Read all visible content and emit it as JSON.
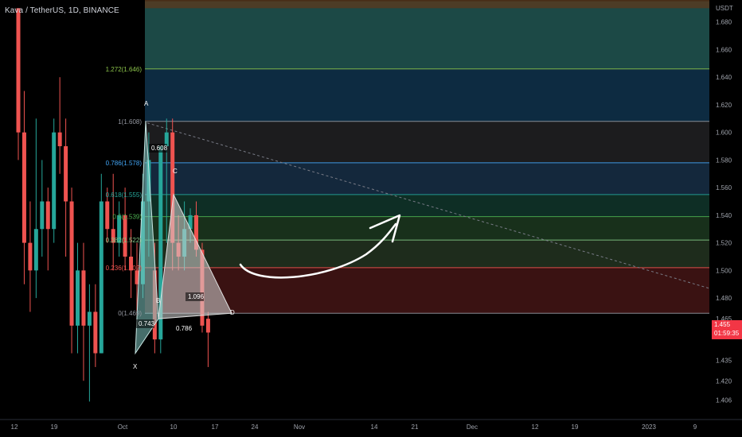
{
  "header": {
    "symbol": "Kava / TetherUS",
    "interval": "1D",
    "exchange": "BINANCE"
  },
  "price_axis": {
    "unit": "USDT",
    "ticks": [
      "1.680",
      "1.660",
      "1.640",
      "1.620",
      "1.600",
      "1.580",
      "1.560",
      "1.540",
      "1.520",
      "1.500",
      "1.480",
      "1.465",
      "1.435",
      "1.420",
      "1.406"
    ],
    "current_price": "1.455",
    "countdown": "01:59:35"
  },
  "time_axis": {
    "ticks": [
      "12",
      "19",
      "Oct",
      "10",
      "17",
      "24",
      "Nov",
      "14",
      "21",
      "Dec",
      "12",
      "19",
      "2023",
      "9"
    ]
  },
  "fib_levels": [
    {
      "label": "1.272(1.646)",
      "color": "#8bc34a"
    },
    {
      "label": "1(1.608)",
      "color": "#9598a1"
    },
    {
      "label": "0.786(1.578)",
      "color": "#42a5f5"
    },
    {
      "label": "0.618(1.555)",
      "color": "#26a69a"
    },
    {
      "label": "0.5(1.539)",
      "color": "#4caf50"
    },
    {
      "label": "0.382(1.522)",
      "color": "#81c784"
    },
    {
      "label": "0.236(1.502)",
      "color": "#ef5350"
    },
    {
      "label": "0(1.469)",
      "color": "#9598a1"
    }
  ],
  "pattern": {
    "points": [
      "X",
      "A",
      "B",
      "C",
      "D"
    ],
    "ratios": [
      "0.608",
      "0.743",
      "1.096",
      "0.786"
    ]
  },
  "colors": {
    "up": "#26a69a",
    "down": "#ef5350",
    "background": "#000000",
    "pattern_fill": "#d6d6d6",
    "arrow": "#ffffff",
    "trendline": "#787b86"
  },
  "chart_data": {
    "type": "candlestick",
    "title": "Kava / TetherUS, 1D, BINANCE",
    "ylabel": "USDT",
    "ylim": [
      1.396,
      1.695
    ],
    "candles": [
      {
        "x": "Sep 10",
        "o": 1.69,
        "h": 1.69,
        "l": 1.58,
        "c": 1.6
      },
      {
        "x": "Sep 11",
        "o": 1.6,
        "h": 1.63,
        "l": 1.49,
        "c": 1.52
      },
      {
        "x": "Sep 12",
        "o": 1.52,
        "h": 1.55,
        "l": 1.47,
        "c": 1.5
      },
      {
        "x": "Sep 13",
        "o": 1.5,
        "h": 1.61,
        "l": 1.48,
        "c": 1.53
      },
      {
        "x": "Sep 14",
        "o": 1.53,
        "h": 1.58,
        "l": 1.51,
        "c": 1.55
      },
      {
        "x": "Sep 15",
        "o": 1.55,
        "h": 1.56,
        "l": 1.5,
        "c": 1.53
      },
      {
        "x": "Sep 16",
        "o": 1.53,
        "h": 1.61,
        "l": 1.52,
        "c": 1.6
      },
      {
        "x": "Sep 17",
        "o": 1.6,
        "h": 1.64,
        "l": 1.57,
        "c": 1.59
      },
      {
        "x": "Sep 18",
        "o": 1.59,
        "h": 1.61,
        "l": 1.51,
        "c": 1.55
      },
      {
        "x": "Sep 19",
        "o": 1.55,
        "h": 1.56,
        "l": 1.44,
        "c": 1.46
      },
      {
        "x": "Sep 20",
        "o": 1.46,
        "h": 1.52,
        "l": 1.44,
        "c": 1.5
      },
      {
        "x": "Sep 21",
        "o": 1.5,
        "h": 1.52,
        "l": 1.42,
        "c": 1.46
      },
      {
        "x": "Sep 22",
        "o": 1.46,
        "h": 1.49,
        "l": 1.405,
        "c": 1.47
      },
      {
        "x": "Sep 23",
        "o": 1.47,
        "h": 1.49,
        "l": 1.43,
        "c": 1.44
      },
      {
        "x": "Sep 24",
        "o": 1.44,
        "h": 1.57,
        "l": 1.44,
        "c": 1.55
      },
      {
        "x": "Sep 25",
        "o": 1.55,
        "h": 1.56,
        "l": 1.52,
        "c": 1.53
      },
      {
        "x": "Sep 26",
        "o": 1.53,
        "h": 1.57,
        "l": 1.5,
        "c": 1.52
      },
      {
        "x": "Sep 27",
        "o": 1.52,
        "h": 1.55,
        "l": 1.51,
        "c": 1.54
      },
      {
        "x": "Sep 28",
        "o": 1.54,
        "h": 1.56,
        "l": 1.5,
        "c": 1.51
      },
      {
        "x": "Sep 29",
        "o": 1.51,
        "h": 1.53,
        "l": 1.48,
        "c": 1.5
      },
      {
        "x": "Sep 30",
        "o": 1.5,
        "h": 1.52,
        "l": 1.46,
        "c": 1.49
      },
      {
        "x": "Oct 1",
        "o": 1.49,
        "h": 1.57,
        "l": 1.48,
        "c": 1.55
      },
      {
        "x": "Oct 2",
        "o": 1.55,
        "h": 1.6,
        "l": 1.51,
        "c": 1.58
      },
      {
        "x": "Oct 3",
        "o": 1.5,
        "h": 1.52,
        "l": 1.44,
        "c": 1.45
      },
      {
        "x": "Oct 4",
        "o": 1.45,
        "h": 1.59,
        "l": 1.44,
        "c": 1.59
      },
      {
        "x": "Oct 5",
        "o": 1.59,
        "h": 1.61,
        "l": 1.52,
        "c": 1.6
      },
      {
        "x": "Oct 6",
        "o": 1.6,
        "h": 1.61,
        "l": 1.5,
        "c": 1.52
      },
      {
        "x": "Oct 7",
        "o": 1.52,
        "h": 1.54,
        "l": 1.5,
        "c": 1.51
      },
      {
        "x": "Oct 8",
        "o": 1.51,
        "h": 1.55,
        "l": 1.5,
        "c": 1.53
      },
      {
        "x": "Oct 9",
        "o": 1.53,
        "h": 1.545,
        "l": 1.52,
        "c": 1.54
      },
      {
        "x": "Oct 10",
        "o": 1.54,
        "h": 1.55,
        "l": 1.51,
        "c": 1.515
      },
      {
        "x": "Oct 11",
        "o": 1.515,
        "h": 1.52,
        "l": 1.455,
        "c": 1.46
      },
      {
        "x": "Oct 12",
        "o": 1.465,
        "h": 1.47,
        "l": 1.43,
        "c": 1.455
      }
    ]
  }
}
